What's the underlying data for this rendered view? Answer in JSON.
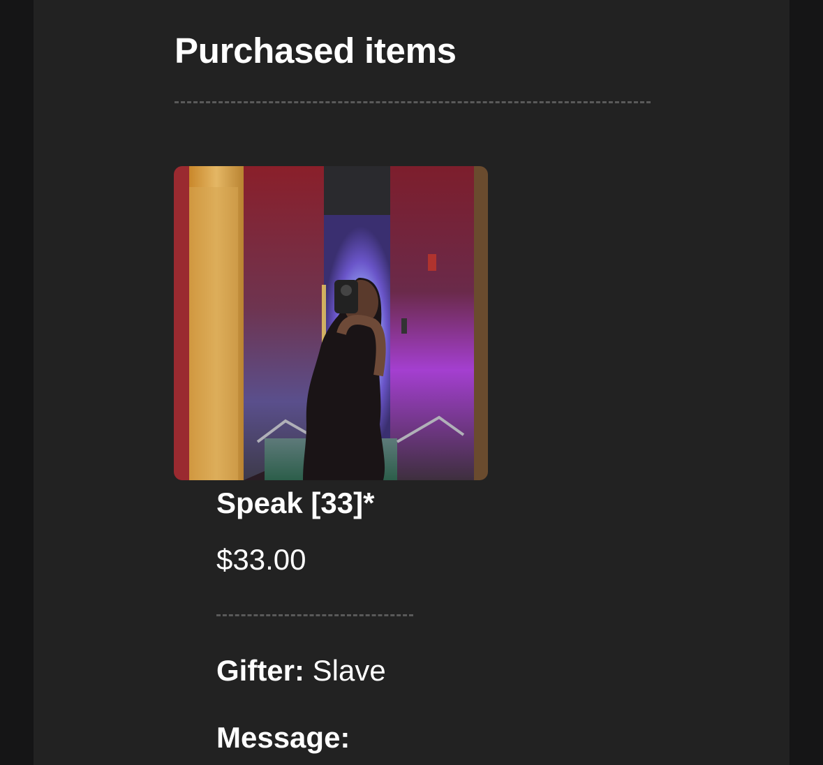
{
  "section": {
    "title": "Purchased items"
  },
  "item": {
    "name": "Speak [33]*",
    "price": "$33.00",
    "image_icon": "photo-icon"
  },
  "gift": {
    "gifter_label": "Gifter:",
    "gifter_value": "Slave",
    "message_label": "Message:"
  },
  "colors": {
    "page_background": "#151516",
    "card_background": "#222222",
    "text": "#ffffff",
    "divider": "#5a5a5a"
  }
}
